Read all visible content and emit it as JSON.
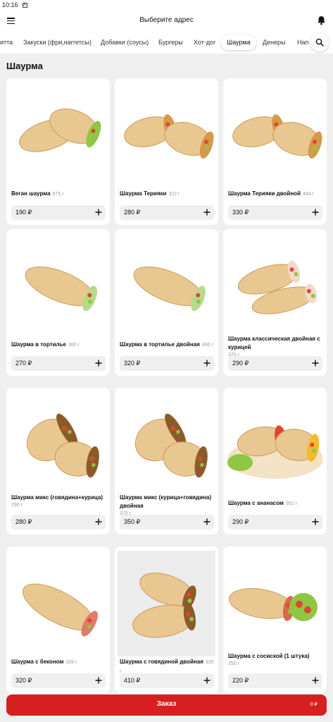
{
  "status": {
    "time": "10:16",
    "badge": "A"
  },
  "header": {
    "title": "Выберите адрес"
  },
  "tabs": [
    {
      "label": "итта"
    },
    {
      "label": "Закуски (фри,наггетсы)"
    },
    {
      "label": "Добавки (соусы)"
    },
    {
      "label": "Бургеры"
    },
    {
      "label": "Хот-дог"
    },
    {
      "label": "Шаурма",
      "active": true
    },
    {
      "label": "Денеры"
    },
    {
      "label": "Нап"
    }
  ],
  "section": {
    "title": "Шаурма"
  },
  "products": [
    {
      "name": "Веган шаурма",
      "weight": "875 г",
      "price": "190 ₽",
      "image": "two-halves-veggie"
    },
    {
      "name": "Шаурма  Терияки",
      "weight": "322 г",
      "price": "280 ₽",
      "image": "two-halves-teriyaki"
    },
    {
      "name": "Шаурма  Терияки двойной",
      "weight": "444 г",
      "price": "330 ₽",
      "image": "two-halves-teriyaki"
    },
    {
      "name": "Шаурма в тортилье",
      "weight": "380 г",
      "price": "270 ₽",
      "image": "single-roll"
    },
    {
      "name": "Шаурма в тортилье двойная",
      "weight": "460 г",
      "price": "320 ₽",
      "image": "single-roll"
    },
    {
      "name": "Шаурма классическая двойная с курицей",
      "weight": "370 г",
      "price": "290 ₽",
      "image": "two-halves-chicken"
    },
    {
      "name": "Шаурма микс (говядина+курица)",
      "weight": "290 г",
      "price": "280 ₽",
      "image": "grilled-meat"
    },
    {
      "name": "Шаурма микс (курица+говядина) двойная",
      "weight": "370 г",
      "price": "350 ₽",
      "image": "grilled-meat"
    },
    {
      "name": "Шаурма с ананасом",
      "weight": "352 г",
      "price": "290 ₽",
      "image": "on-plate"
    },
    {
      "name": "Шаурма с беконом",
      "weight": "328 г",
      "price": "320 ₽",
      "image": "bacon-roll"
    },
    {
      "name": "Шаурма с говядиной двойная",
      "weight": "320 г",
      "price": "410 ₽",
      "image": "grilled-meat-grey"
    },
    {
      "name": "Шаурма с сосиской (1 штука)",
      "weight": "250 г",
      "price": "220 ₽",
      "image": "sausage-salad"
    }
  ],
  "order": {
    "label": "Заказ",
    "total": "0 ₽"
  },
  "icons": {
    "menu": "menu-icon",
    "bell": "bell-icon",
    "search": "search-icon",
    "add": "plus-icon"
  },
  "colors": {
    "accent": "#d71f1f",
    "background": "#efefef",
    "card": "#ffffff"
  }
}
